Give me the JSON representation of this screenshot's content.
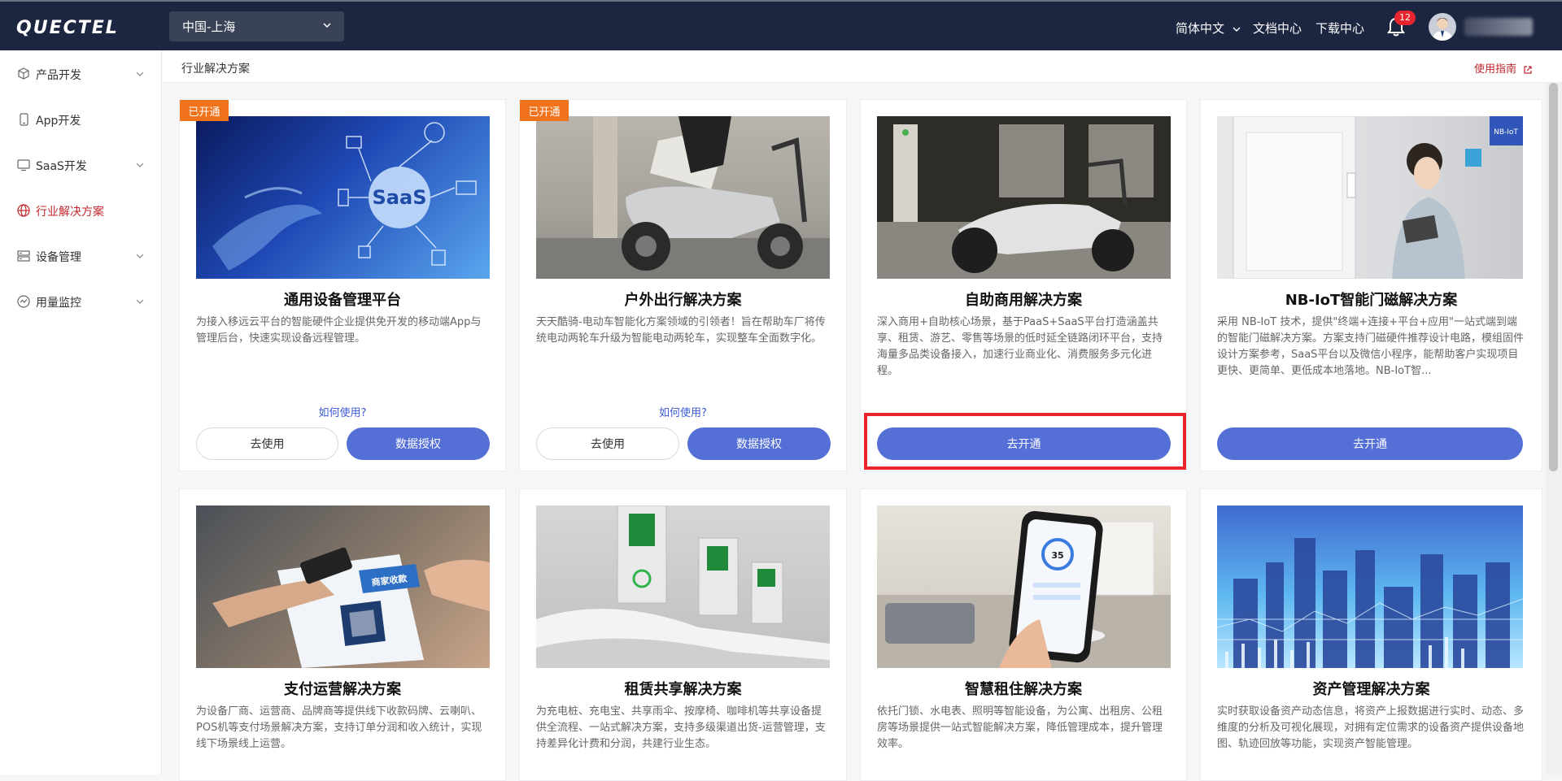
{
  "header": {
    "brand": "QUECTEL",
    "region": "中国-上海",
    "lang": "简体中文",
    "docs": "文档中心",
    "downloads": "下载中心",
    "notifications": "12"
  },
  "sidebar": {
    "items": [
      {
        "label": "产品开发",
        "icon": "cube-icon",
        "expandable": true
      },
      {
        "label": "App开发",
        "icon": "phone-icon",
        "expandable": false
      },
      {
        "label": "SaaS开发",
        "icon": "monitor-icon",
        "expandable": true
      },
      {
        "label": "行业解决方案",
        "icon": "globe-icon",
        "expandable": false,
        "active": true
      },
      {
        "label": "设备管理",
        "icon": "server-icon",
        "expandable": true
      },
      {
        "label": "用量监控",
        "icon": "gauge-icon",
        "expandable": true
      }
    ]
  },
  "topbar": {
    "breadcrumb": "行业解决方案",
    "guide": "使用指南"
  },
  "cards": [
    {
      "tag": "已开通",
      "title": "通用设备管理平台",
      "desc": "为接入移远云平台的智能硬件企业提供免开发的移动端App与管理后台，快速实现设备远程管理。",
      "howto": "如何使用?",
      "btn1": "去使用",
      "btn2": "数据授权",
      "image": "SaaS network illustration"
    },
    {
      "tag": "已开通",
      "title": "户外出行解决方案",
      "desc": "天天酷骑-电动车智能化方案领域的引领者！旨在帮助车厂将传统电动两轮车升级为智能电动两轮车，实现整车全面数字化。",
      "howto": "如何使用?",
      "btn1": "去使用",
      "btn2": "数据授权",
      "image": "electric scooter"
    },
    {
      "title": "自助商用解决方案",
      "desc": "深入商用+自助核心场景，基于PaaS+SaaS平台打造涵盖共享、租赁、游艺、零售等场景的低时延全链路闭环平台，支持海量多品类设备接入，加速行业商业化、消费服务多元化进程。",
      "btn1": "去开通",
      "image": "scooter charging station"
    },
    {
      "title": "NB-IoT智能门磁解决方案",
      "desc": "采用 NB-IoT 技术，提供\"终端+连接+平台+应用\"一站式端到端的智能门磁解决方案。方案支持门磁硬件推荐设计电路，模组固件设计方案参考，SaaS平台以及微信小程序，能帮助客户实现项目更快、更简单、更低成本地落地。NB-IoT智...",
      "btn1": "去开通",
      "image": "woman with tablet by door",
      "image_label": "NB-IoT"
    },
    {
      "title": "支付运营解决方案",
      "desc": "为设备厂商、运营商、品牌商等提供线下收款码牌、云喇叭、POS机等支付场景解决方案，支持订单分润和收入统计，实现线下场景线上运营。",
      "image": "QR payment",
      "image_label": "商家收款"
    },
    {
      "title": "租赁共享解决方案",
      "desc": "为充电桩、充电宝、共享雨伞、按摩椅、咖啡机等共享设备提供全流程、一站式解决方案，支持多级渠道出货-运营管理，支持差异化计费和分润，共建行业生态。",
      "image": "EV chargers"
    },
    {
      "title": "智慧租住解决方案",
      "desc": "依托门锁、水电表、照明等智能设备，为公寓、出租房、公租房等场景提供一站式智能解决方案，降低管理成本，提升管理效率。",
      "image": "smart home phone",
      "image_label": "35"
    },
    {
      "title": "资产管理解决方案",
      "desc": "实时获取设备资产动态信息，将资产上报数据进行实时、动态、多维度的分析及可视化展现，对拥有定位需求的设备资产提供设备地图、轨迹回放等功能，实现资产智能管理。",
      "image": "city data visualization"
    }
  ],
  "colors": {
    "header_bg": "#1d2640",
    "primary": "#5470d6",
    "accent_red": "#c0272d",
    "tag_orange": "#f0731c",
    "highlight": "#e8252f"
  }
}
